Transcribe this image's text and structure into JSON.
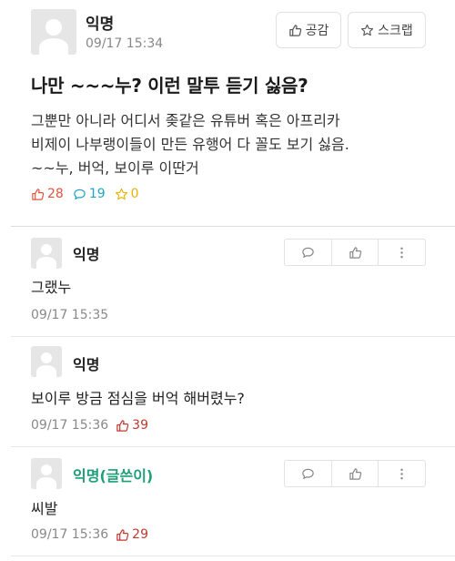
{
  "post": {
    "author": "익명",
    "date": "09/17 15:34",
    "like_button_label": "공감",
    "scrap_button_label": "스크랩",
    "title": "나만 ~~~누? 이런 말투 듣기 싫음?",
    "body_lines": [
      "그뿐만 아니라 어디서 좆같은 유튜버 혹은 아프리카",
      "비제이 나부랭이들이 만든 유행어 다 꼴도 보기 싫음.",
      "~~누, 버억, 보이루 이딴거"
    ],
    "stats": {
      "likes": "28",
      "comments": "19",
      "scraps": "0"
    },
    "colors": {
      "like": "#e0533f",
      "comment": "#22a3c2",
      "scrap": "#e8b200"
    }
  },
  "comments": [
    {
      "author": "익명",
      "text": "그랬누",
      "date": "09/17 15:35",
      "likes": ""
    },
    {
      "author": "익명",
      "text": "보이루 방금 점심을 버억 해버렸누?",
      "date": "09/17 15:36",
      "likes": "39"
    },
    {
      "author": "익명(글쓴이)",
      "text": "씨발",
      "date": "09/17 15:36",
      "likes": "29"
    }
  ],
  "icons": {
    "avatar": "default-avatar-icon",
    "like": "thumbs-up-icon",
    "comment": "speech-bubble-icon",
    "scrap": "star-icon",
    "more": "more-vertical-icon"
  }
}
